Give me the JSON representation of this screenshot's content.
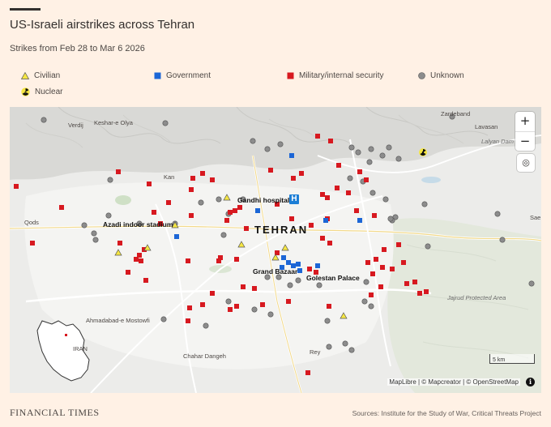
{
  "header": {
    "title": "US-Israeli airstrikes across Tehran",
    "subtitle": "Strikes from Feb 28 to Mar 6 2026"
  },
  "legend": [
    {
      "label": "Civilian",
      "icon": "triangle",
      "color": "#f5e642"
    },
    {
      "label": "Government",
      "icon": "square",
      "color": "#1c66d6"
    },
    {
      "label": "Military/internal security",
      "icon": "square",
      "color": "#d71920"
    },
    {
      "label": "Unknown",
      "icon": "circle",
      "color": "#8c8c8c"
    },
    {
      "label": "Nuclear",
      "icon": "radiation",
      "color": "#f5e642"
    }
  ],
  "map": {
    "city_label": "TEHRAN",
    "places": [
      "Zardeband",
      "Lavasan",
      "Lalyan Dam",
      "Keshar-e Olya",
      "Verdij",
      "Kan",
      "Qods",
      "Sae",
      "Ahmadabad-e Mostowfi",
      "Chahar Dangeh",
      "Rey",
      "Jajrud Protected Area"
    ],
    "landmarks": [
      "Gandhi hospital",
      "Azadi indoor stadium",
      "Grand Bazaar",
      "Golestan Palace"
    ],
    "inset_label": "IRAN",
    "controls": {
      "zoom_in": "+",
      "zoom_out": "−"
    },
    "scale_label": "5 km",
    "attribution": "MapLibre | © Mapcreator | © OpenStreetMap",
    "info_label": "i"
  },
  "footer": {
    "brand": "FINANCIAL TIMES",
    "sources": "Sources: Institute for the Study of War, Critical Threats Project"
  },
  "colors": {
    "background": "#fff1e5",
    "civilian": "#f5e642",
    "government": "#1c66d6",
    "military": "#d71920",
    "unknown": "#8c8c8c"
  }
}
